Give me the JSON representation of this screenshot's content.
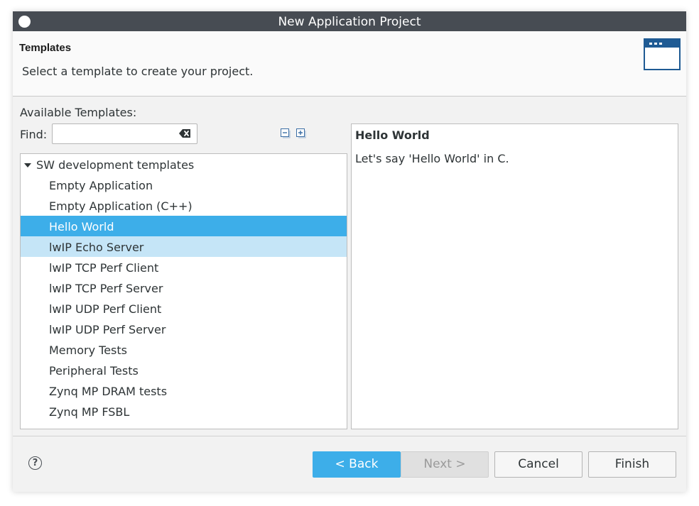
{
  "window": {
    "title": "New Application Project"
  },
  "header": {
    "title": "Templates",
    "description": "Select a template to create your project."
  },
  "templates": {
    "available_label": "Available Templates:",
    "find_label": "Find:",
    "find_value": "",
    "root_label": "SW development templates",
    "items": [
      "Empty Application",
      "Empty Application (C++)",
      "Hello World",
      "lwIP Echo Server",
      "lwIP TCP Perf Client",
      "lwIP TCP Perf Server",
      "lwIP UDP Perf Client",
      "lwIP UDP Perf Server",
      "Memory Tests",
      "Peripheral Tests",
      "Zynq MP DRAM tests",
      "Zynq MP FSBL"
    ],
    "selected_item": "Hello World",
    "hovered_item": "lwIP Echo Server"
  },
  "description_panel": {
    "title": "Hello World",
    "text": "Let's say 'Hello World' in C."
  },
  "buttons": {
    "back": "< Back",
    "next": "Next >",
    "cancel": "Cancel",
    "finish": "Finish",
    "help": "?"
  },
  "colors": {
    "selection": "#3daee9",
    "hover": "#c5e5f7",
    "titlebar": "#474c53"
  },
  "icons": {
    "window": "circle-icon",
    "header": "application-window-icon",
    "clear": "clear-input-icon",
    "collapse": "collapse-all-icon",
    "expand": "expand-all-icon",
    "help": "help-icon"
  }
}
